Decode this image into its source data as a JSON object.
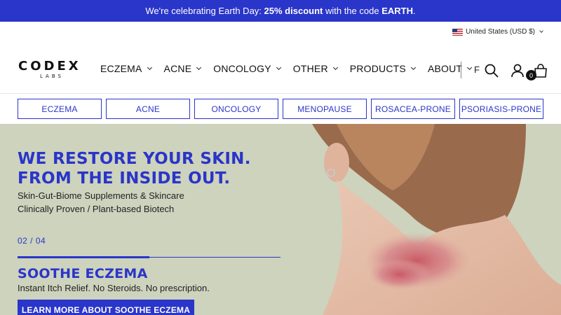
{
  "announcement": {
    "prefix": "We're celebrating Earth Day: ",
    "discount": "25% discount",
    "middle": " with the code ",
    "code": "EARTH",
    "suffix": "."
  },
  "locale": {
    "label": "United States (USD $)",
    "icon": "us-flag-icon"
  },
  "brand": {
    "name": "CODEX",
    "sub": "LABS"
  },
  "nav": {
    "items": [
      {
        "label": "ECZEMA"
      },
      {
        "label": "ACNE"
      },
      {
        "label": "ONCOLOGY"
      },
      {
        "label": "OTHER"
      },
      {
        "label": "PRODUCTS"
      },
      {
        "label": "ABOUT"
      }
    ],
    "partial_text": "F"
  },
  "cart": {
    "count": "0"
  },
  "categories": [
    "ECZEMA",
    "ACNE",
    "ONCOLOGY",
    "MENOPAUSE",
    "ROSACEA-PRONE",
    "PSORIASIS-PRONE"
  ],
  "hero": {
    "title": "WE RESTORE YOUR SKIN. FROM THE INSIDE OUT.",
    "subtitle1": "Skin-Gut-Biome Supplements & Skincare",
    "subtitle2": "Clinically Proven / Plant-based Biotech",
    "counter": "02 / 04",
    "slide_progress": 0.5,
    "slide_title": "SOOTHE ECZEMA",
    "slide_desc": "Instant Itch Relief. No Steroids. No prescription.",
    "cta": "LEARN MORE ABOUT SOOTHE ECZEMA"
  },
  "colors": {
    "brand_blue": "#2a35c9",
    "hero_bg": "#cdd3bd"
  }
}
